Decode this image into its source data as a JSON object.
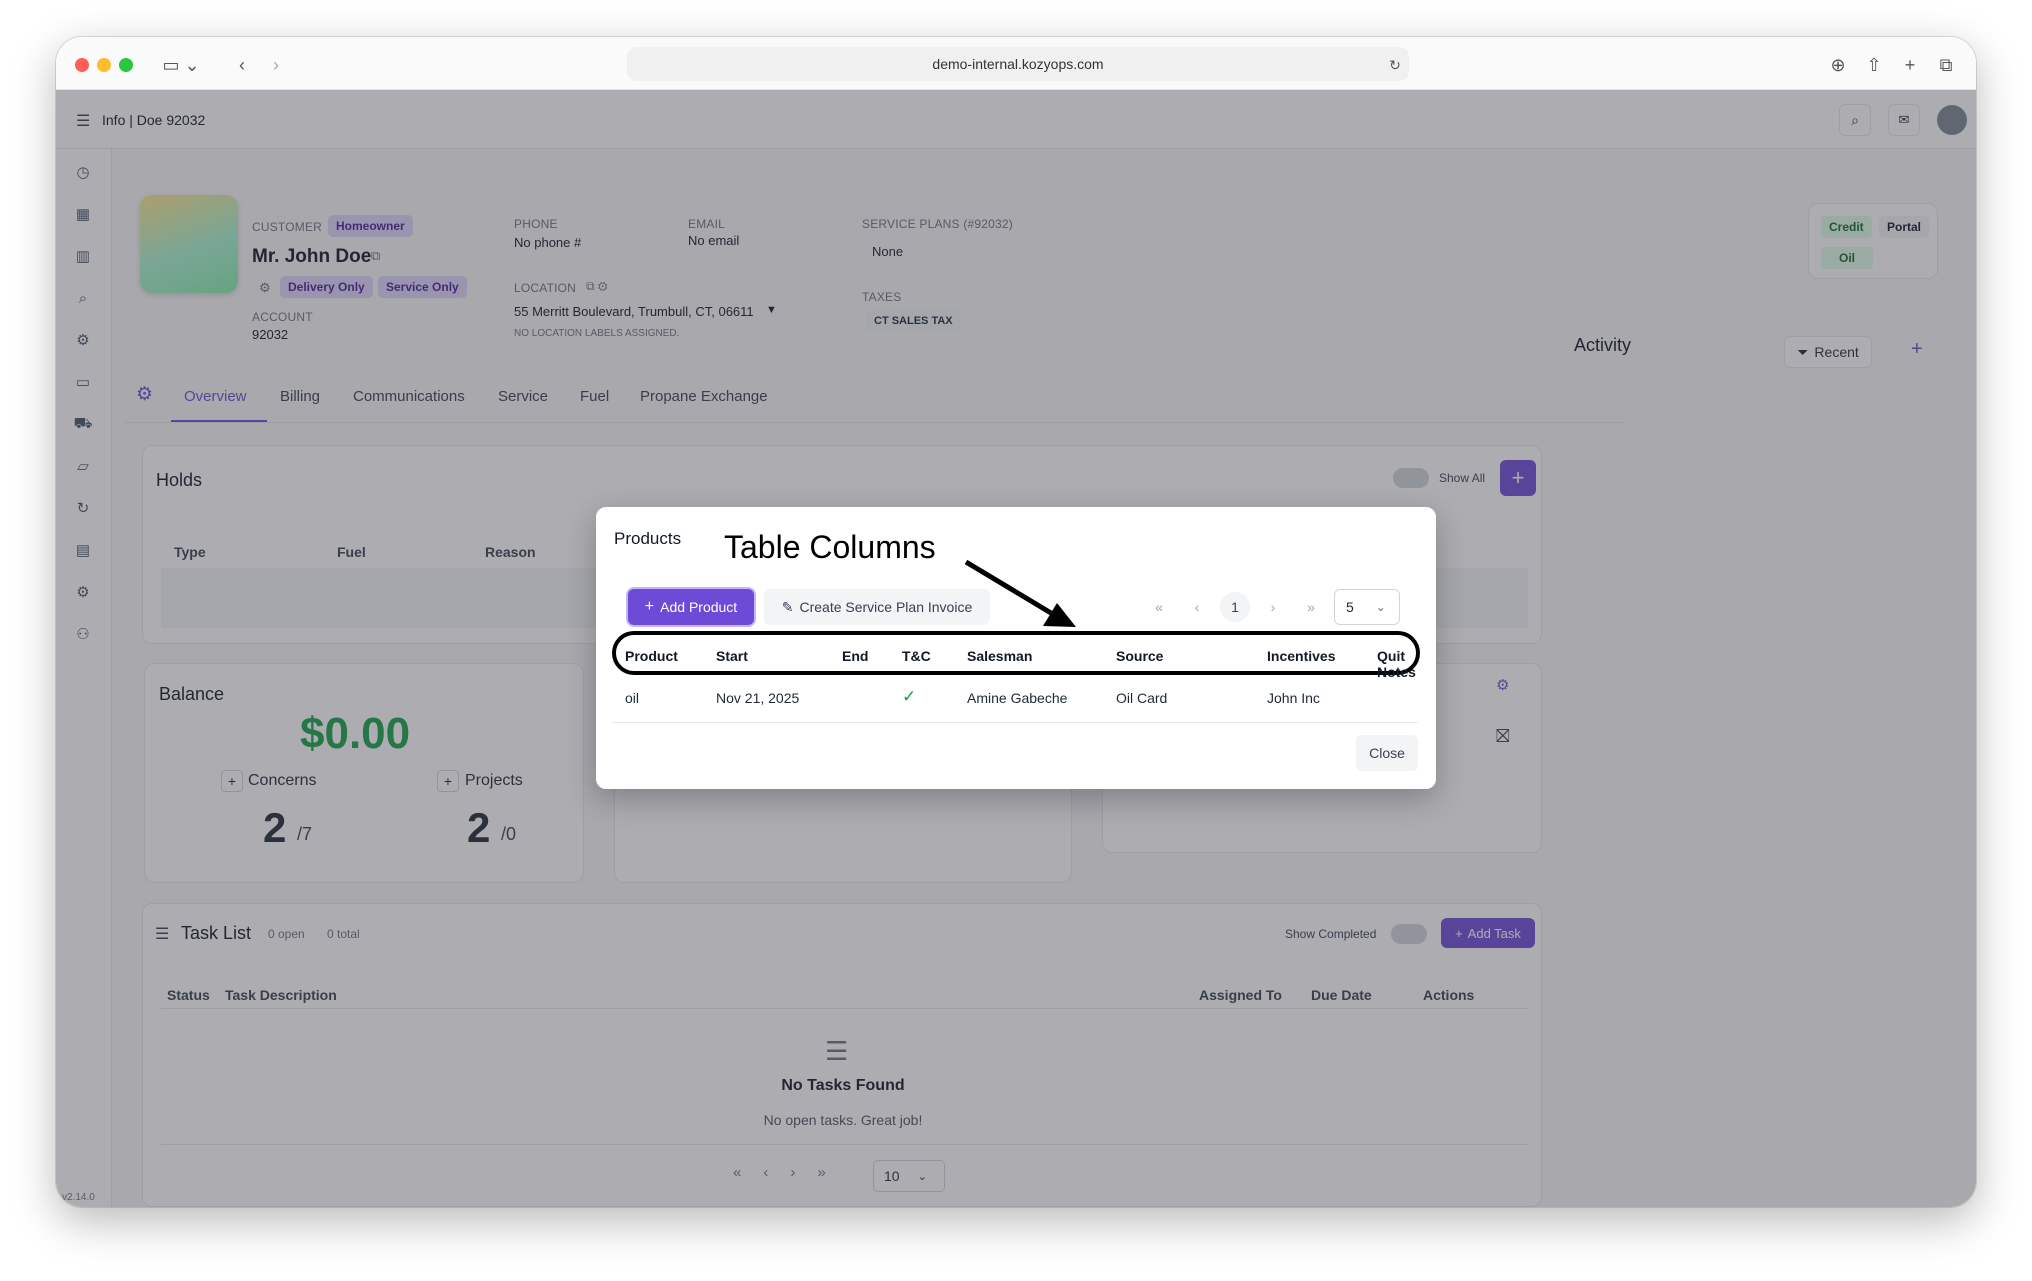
{
  "browser": {
    "url": "demo-internal.kozyops.com"
  },
  "header": {
    "title": "Info | Doe 92032"
  },
  "customer": {
    "customer_label": "CUSTOMER",
    "type_badge": "Homeowner",
    "name": "Mr. John Doe",
    "badges": [
      "Delivery Only",
      "Service Only"
    ],
    "account_label": "ACCOUNT",
    "account": "92032",
    "phone_label": "PHONE",
    "phone": "No phone #",
    "email_label": "EMAIL",
    "email": "No email",
    "location_label": "LOCATION",
    "location": "55 Merritt Boulevard, Trumbull, CT, 06611",
    "location_note": "NO LOCATION LABELS ASSIGNED.",
    "plans_label": "SERVICE PLANS (#92032)",
    "plans": "None",
    "taxes_label": "TAXES",
    "tax": "CT SALES TAX"
  },
  "status_tags": [
    "Credit",
    "Portal",
    "Oil"
  ],
  "tabs": [
    "Overview",
    "Billing",
    "Communications",
    "Service",
    "Fuel",
    "Propane Exchange"
  ],
  "activity": {
    "title": "Activity",
    "filter": "Recent"
  },
  "holds": {
    "title": "Holds",
    "toggle": "Show All",
    "columns": [
      "Type",
      "Fuel",
      "Reason"
    ]
  },
  "balance": {
    "title": "Balance",
    "amount": "$0.00",
    "concerns_label": "Concerns",
    "concerns_count": "2",
    "concerns_total": "/7",
    "projects_label": "Projects",
    "projects_count": "2",
    "projects_total": "/0"
  },
  "tasks": {
    "title": "Task List",
    "open": "0 open",
    "total": "0 total",
    "show_completed": "Show Completed",
    "add": "Add Task",
    "columns": [
      "Status",
      "Task Description",
      "Assigned To",
      "Due Date",
      "Actions"
    ],
    "empty_title": "No Tasks Found",
    "empty_sub": "No open tasks. Great job!",
    "page_size": "10"
  },
  "version": "v2.14.0",
  "modal": {
    "title": "Products",
    "add": "Add Product",
    "invoice": "Create Service Plan Invoice",
    "page": "1",
    "page_size": "5",
    "columns": [
      "Product",
      "Start",
      "End",
      "T&C",
      "Salesman",
      "Source",
      "Incentives",
      "Quit Notes"
    ],
    "rows": [
      {
        "product": "oil",
        "start": "Nov 21, 2025",
        "end": "",
        "tc": "✓",
        "salesman": "Amine Gabeche",
        "source": "Oil Card",
        "incentives": "John Inc",
        "quit": ""
      }
    ],
    "close": "Close"
  },
  "annotation": {
    "text": "Table Columns"
  },
  "colors": {
    "accent": "#6d4bd6",
    "green": "#16a34a",
    "annotation": "#000000"
  }
}
